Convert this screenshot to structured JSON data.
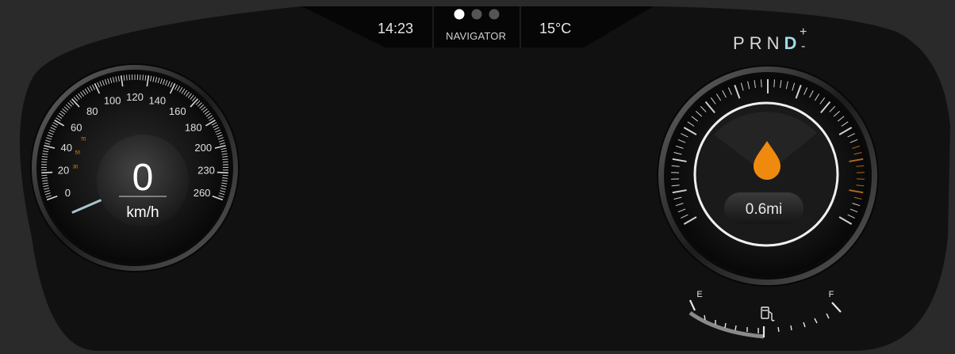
{
  "header": {
    "time": "14:23",
    "app_label": "NAVIGATOR",
    "temperature": "15°C",
    "page_dots": {
      "count": 3,
      "active_index": 0
    }
  },
  "gear_selector": {
    "positions": [
      "P",
      "R",
      "N",
      "D"
    ],
    "active": "D",
    "plus": "+",
    "minus": "-"
  },
  "speedometer": {
    "speed": "0",
    "unit": "km/h",
    "scale_labels": [
      "0",
      "20",
      "40",
      "60",
      "80",
      "100",
      "120",
      "140",
      "160",
      "180",
      "200",
      "230",
      "260"
    ],
    "minor_labels": [
      "30",
      "50",
      "70"
    ]
  },
  "range_gauge": {
    "value": "0.6mi",
    "icon": "fuel-drop-icon"
  },
  "fuel_gauge": {
    "empty_label": "E",
    "full_label": "F",
    "level": 0.5,
    "icon": "fuel-pump-icon"
  },
  "colors": {
    "accent_orange": "#f08a0e",
    "gear_active": "#9fd9e6",
    "background": "#111111"
  }
}
